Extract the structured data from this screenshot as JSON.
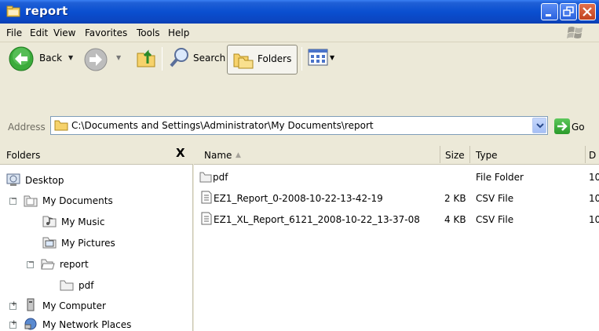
{
  "window": {
    "title": "report",
    "controls": [
      "minimize",
      "maximize",
      "close"
    ]
  },
  "menu": {
    "items": [
      "File",
      "Edit",
      "View",
      "Favorites",
      "Tools",
      "Help"
    ]
  },
  "toolbar": {
    "back_label": "Back",
    "search_label": "Search",
    "folders_label": "Folders"
  },
  "address": {
    "label": "Address",
    "value": "C:\\Documents and Settings\\Administrator\\My Documents\\report",
    "go_label": "Go"
  },
  "folders_pane": {
    "title": "Folders",
    "close_glyph": "X",
    "tree": [
      {
        "label": "Desktop",
        "icon": "desktop-icon"
      },
      {
        "label": "My Documents",
        "icon": "my-documents-icon",
        "toggle": "−"
      },
      {
        "label": "My Music",
        "icon": "my-music-icon"
      },
      {
        "label": "My Pictures",
        "icon": "my-pictures-icon"
      },
      {
        "label": "report",
        "icon": "folder-open-icon",
        "toggle": "−"
      },
      {
        "label": "pdf",
        "icon": "folder-icon"
      },
      {
        "label": "My Computer",
        "icon": "my-computer-icon",
        "toggle": "+"
      },
      {
        "label": "My Network Places",
        "icon": "network-places-icon",
        "toggle": "+"
      }
    ]
  },
  "file_list": {
    "columns": [
      "Name",
      "Size",
      "Type",
      "D"
    ],
    "sort_indicator": "▲",
    "rows": [
      {
        "name": "pdf",
        "size": "",
        "type": "File Folder",
        "date": "10",
        "icon": "folder-icon"
      },
      {
        "name": "EZ1_Report_0-2008-10-22-13-42-19",
        "size": "2 KB",
        "type": "CSV File",
        "date": "10",
        "icon": "csv-file-icon"
      },
      {
        "name": "EZ1_XL_Report_6121_2008-10-22_13-37-08",
        "size": "4 KB",
        "type": "CSV File",
        "date": "10",
        "icon": "csv-file-icon"
      }
    ]
  },
  "colors": {
    "titlebar": "#0a4fd0",
    "face": "#ece9d8",
    "selection": "#316ac5"
  }
}
